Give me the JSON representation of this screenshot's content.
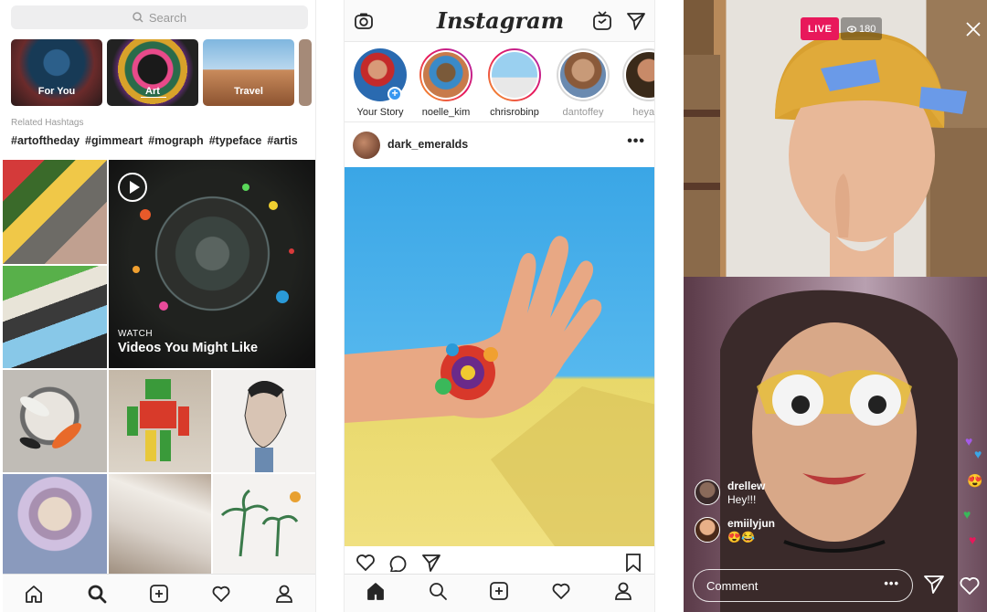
{
  "explore": {
    "search": {
      "placeholder": "Search",
      "icon": "search-icon"
    },
    "topics": [
      {
        "label": "For You"
      },
      {
        "label": "Art"
      },
      {
        "label": "Travel"
      }
    ],
    "related_label": "Related Hashtags",
    "hashtags": [
      "#artoftheday",
      "#gimmeart",
      "#mograph",
      "#typeface",
      "#artis"
    ],
    "video_tile": {
      "kicker": "WATCH",
      "title": "Videos You Might Like"
    },
    "tabs": [
      "home-icon",
      "search-icon",
      "add-icon",
      "heart-icon",
      "profile-icon"
    ]
  },
  "feed": {
    "logo": "Instagram",
    "stories": [
      {
        "name": "Your Story",
        "seen": false
      },
      {
        "name": "noelle_kim",
        "seen": false
      },
      {
        "name": "chrisrobinp",
        "seen": false
      },
      {
        "name": "dantoffey",
        "seen": true
      },
      {
        "name": "heyach",
        "seen": true
      }
    ],
    "post": {
      "username": "dark_emeralds",
      "more": "•••"
    },
    "tabs": [
      "home-icon",
      "search-icon",
      "add-icon",
      "heart-icon",
      "profile-icon"
    ]
  },
  "live": {
    "badge": "LIVE",
    "viewers": "180",
    "comments": [
      {
        "user": "drellew",
        "text": "Hey!!!"
      },
      {
        "user": "emiilyjun",
        "text": "😍😂"
      }
    ],
    "comment_placeholder": "Comment",
    "comment_more": "•••",
    "colors": {
      "live": "#e8185b",
      "accent": "#3897f0"
    }
  }
}
